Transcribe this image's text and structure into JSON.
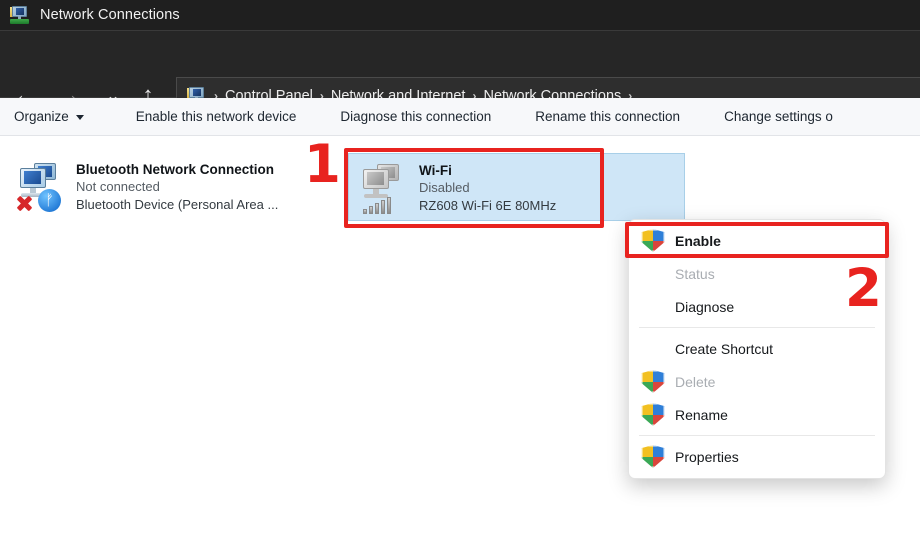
{
  "window": {
    "title": "Network Connections",
    "title_icon": "network-connections-icon"
  },
  "addressbar": {
    "back_icon": "arrow-left-icon",
    "forward_icon": "arrow-right-icon",
    "recent_icon": "chevron-down-icon",
    "up_icon": "arrow-up-icon",
    "breadcrumb_icon": "network-connections-icon",
    "separator": "›",
    "crumbs": [
      "Control Panel",
      "Network and Internet",
      "Network Connections"
    ]
  },
  "commandbar": {
    "organize": "Organize",
    "organize_caret": "chevron-down-icon",
    "enable_device": "Enable this network device",
    "diagnose": "Diagnose this connection",
    "rename": "Rename this connection",
    "change_settings": "Change settings o"
  },
  "connections": [
    {
      "id": "bluetooth",
      "name": "Bluetooth Network Connection",
      "state": "Not connected",
      "device": "Bluetooth Device (Personal Area ...",
      "icon": "network-adapter-icon",
      "badge": "bluetooth-badge-icon",
      "error_badge": "red-x-icon",
      "selected": false
    },
    {
      "id": "wifi",
      "name": "Wi-Fi",
      "state": "Disabled",
      "device": "RZ608 Wi-Fi 6E 80MHz",
      "icon": "network-adapter-disabled-icon",
      "badge": "signal-bars-icon",
      "selected": true
    }
  ],
  "context_menu": {
    "items": [
      {
        "label": "Enable",
        "icon": "uac-shield-icon",
        "bold": true,
        "disabled": false,
        "separator_after": false
      },
      {
        "label": "Status",
        "icon": null,
        "bold": false,
        "disabled": true,
        "separator_after": false
      },
      {
        "label": "Diagnose",
        "icon": null,
        "bold": false,
        "disabled": false,
        "separator_after": true
      },
      {
        "label": "Create Shortcut",
        "icon": null,
        "bold": false,
        "disabled": false,
        "separator_after": false
      },
      {
        "label": "Delete",
        "icon": "uac-shield-icon",
        "bold": false,
        "disabled": true,
        "separator_after": false
      },
      {
        "label": "Rename",
        "icon": "uac-shield-icon",
        "bold": false,
        "disabled": false,
        "separator_after": true
      },
      {
        "label": "Properties",
        "icon": "uac-shield-icon",
        "bold": false,
        "disabled": false,
        "separator_after": false
      }
    ]
  },
  "annotations": {
    "step_one": "1",
    "step_two": "2",
    "color": "#e8231f"
  }
}
